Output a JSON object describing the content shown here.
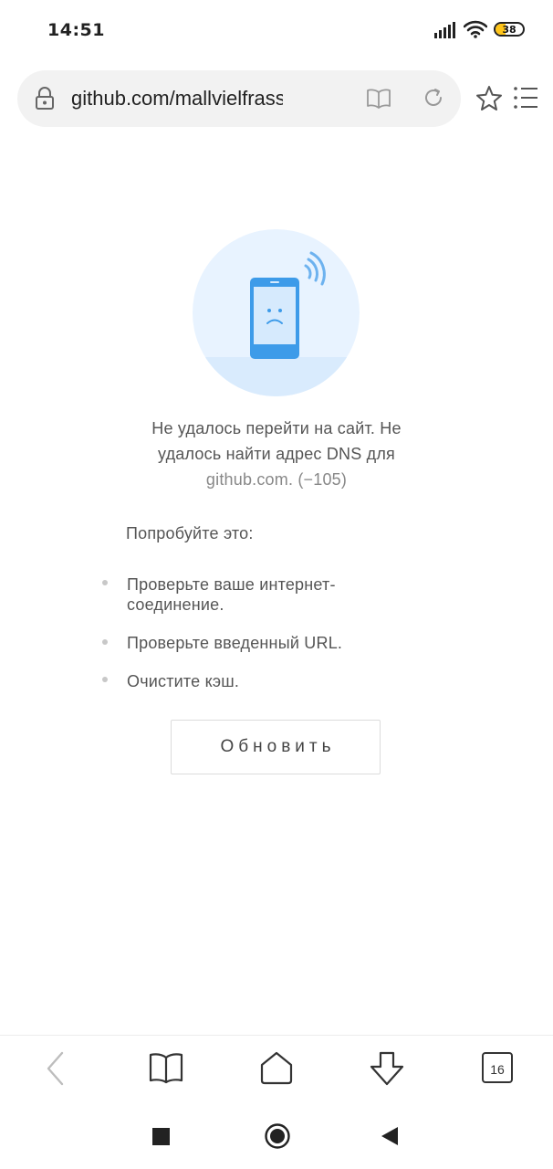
{
  "status_bar": {
    "time": "14:51",
    "battery_percent": 38,
    "battery_label": "38",
    "icons": [
      "signal-icon",
      "wifi-icon",
      "battery-icon"
    ]
  },
  "address_bar": {
    "url": "github.com/mallvielfrass/FPat",
    "icons": [
      "lock-icon",
      "reader-mode-icon",
      "reload-icon"
    ]
  },
  "toolbar_right": {
    "icons": [
      "star-icon",
      "menu-icon"
    ]
  },
  "error_page": {
    "message": "Не удалось перейти на сайт. Не удалось найти адрес DNS для",
    "host_code": "github.com. (−105)",
    "try_heading": "Попробуйте это:",
    "suggestions": [
      "Проверьте ваше интернет-соединение.",
      "Проверьте введенный URL.",
      "Очистите кэш."
    ],
    "reload_button": "Обновить"
  },
  "bottom_toolbar": {
    "icons": [
      "back-icon",
      "bookmarks-icon",
      "home-icon",
      "download-icon",
      "tabs-icon"
    ],
    "tabs_count": "16"
  },
  "system_nav": {
    "icons": [
      "recents-icon",
      "home-icon",
      "back-icon"
    ]
  },
  "colors": {
    "accent_blue": "#3d9be9",
    "illustration_bg": "#e8f3ff",
    "address_bar_bg": "#f2f2f2",
    "battery_fill": "#ffc51a"
  }
}
